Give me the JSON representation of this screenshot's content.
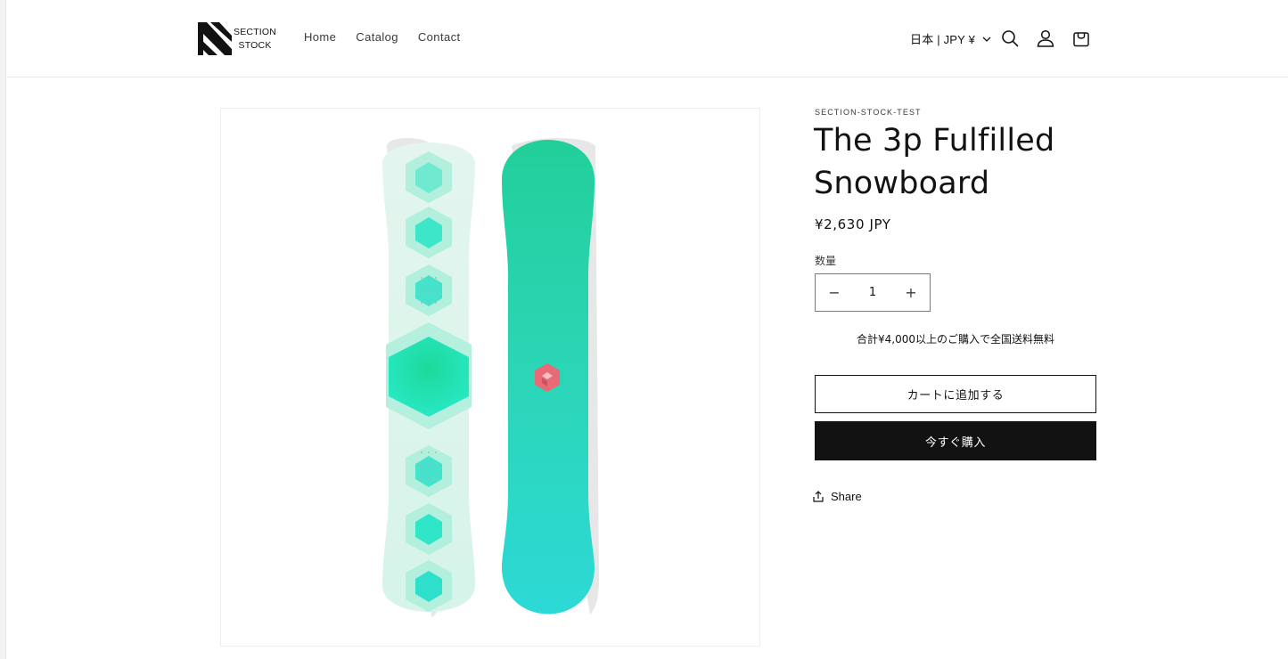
{
  "brand": {
    "line1": "SECTION",
    "line2": "STOCK"
  },
  "nav": {
    "items": [
      "Home",
      "Catalog",
      "Contact"
    ]
  },
  "header": {
    "locale": "日本 | JPY ¥",
    "icons": [
      "search-icon",
      "account-icon",
      "cart-icon"
    ]
  },
  "product": {
    "vendor": "SECTION-STOCK-TEST",
    "title": "The 3p Fulfilled Snowboard",
    "price": "¥2,630 JPY",
    "quantity_label": "数量",
    "quantity_value": "1",
    "decrease_symbol": "−",
    "increase_symbol": "+",
    "shipping_note": "合計¥4,000以上のご購入で全国送料無料",
    "add_to_cart_label": "カートに追加する",
    "buy_now_label": "今すぐ購入",
    "share_label": "Share"
  },
  "colors": {
    "text": "#121212",
    "buy_button_bg": "#121212",
    "board_mint": "#1fd3a4",
    "board_teal": "#2bd8d4",
    "board_light": "#d8f3ea",
    "logo_pink": "#e86a76"
  }
}
